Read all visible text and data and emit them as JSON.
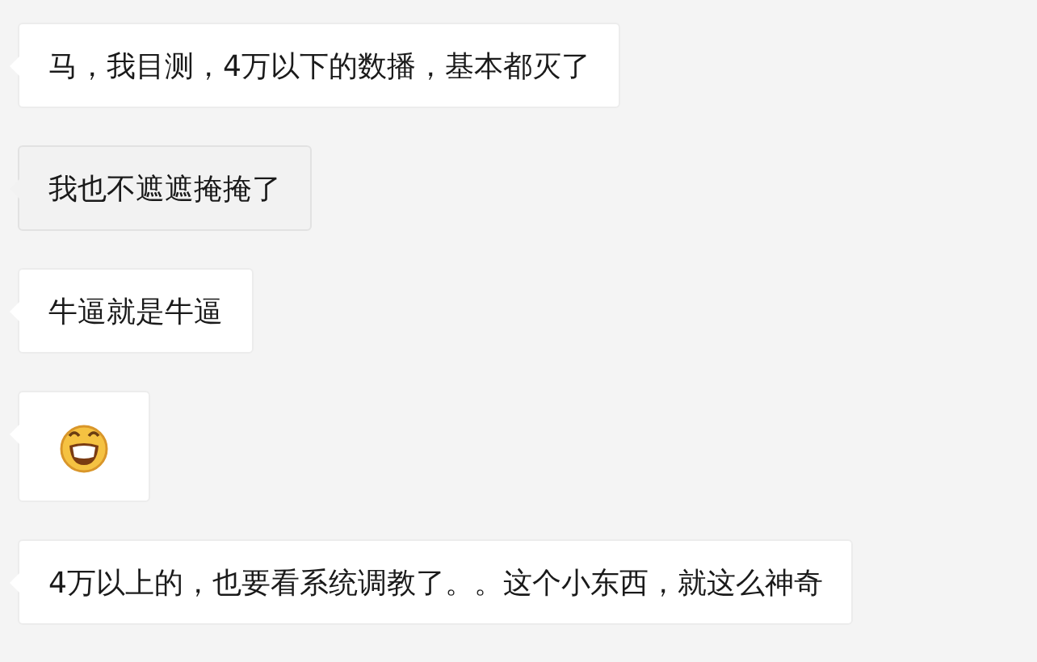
{
  "messages": [
    {
      "kind": "text",
      "text": "马，我目测，4万以下的数播，基本都灭了",
      "highlighted": false
    },
    {
      "kind": "text",
      "text": "我也不遮遮掩掩了",
      "highlighted": true
    },
    {
      "kind": "text",
      "text": "牛逼就是牛逼",
      "highlighted": false
    },
    {
      "kind": "emoji",
      "highlighted": false
    },
    {
      "kind": "text",
      "text": "4万以上的，也要看系统调教了。。这个小东西，就这么神奇",
      "highlighted": false
    }
  ]
}
